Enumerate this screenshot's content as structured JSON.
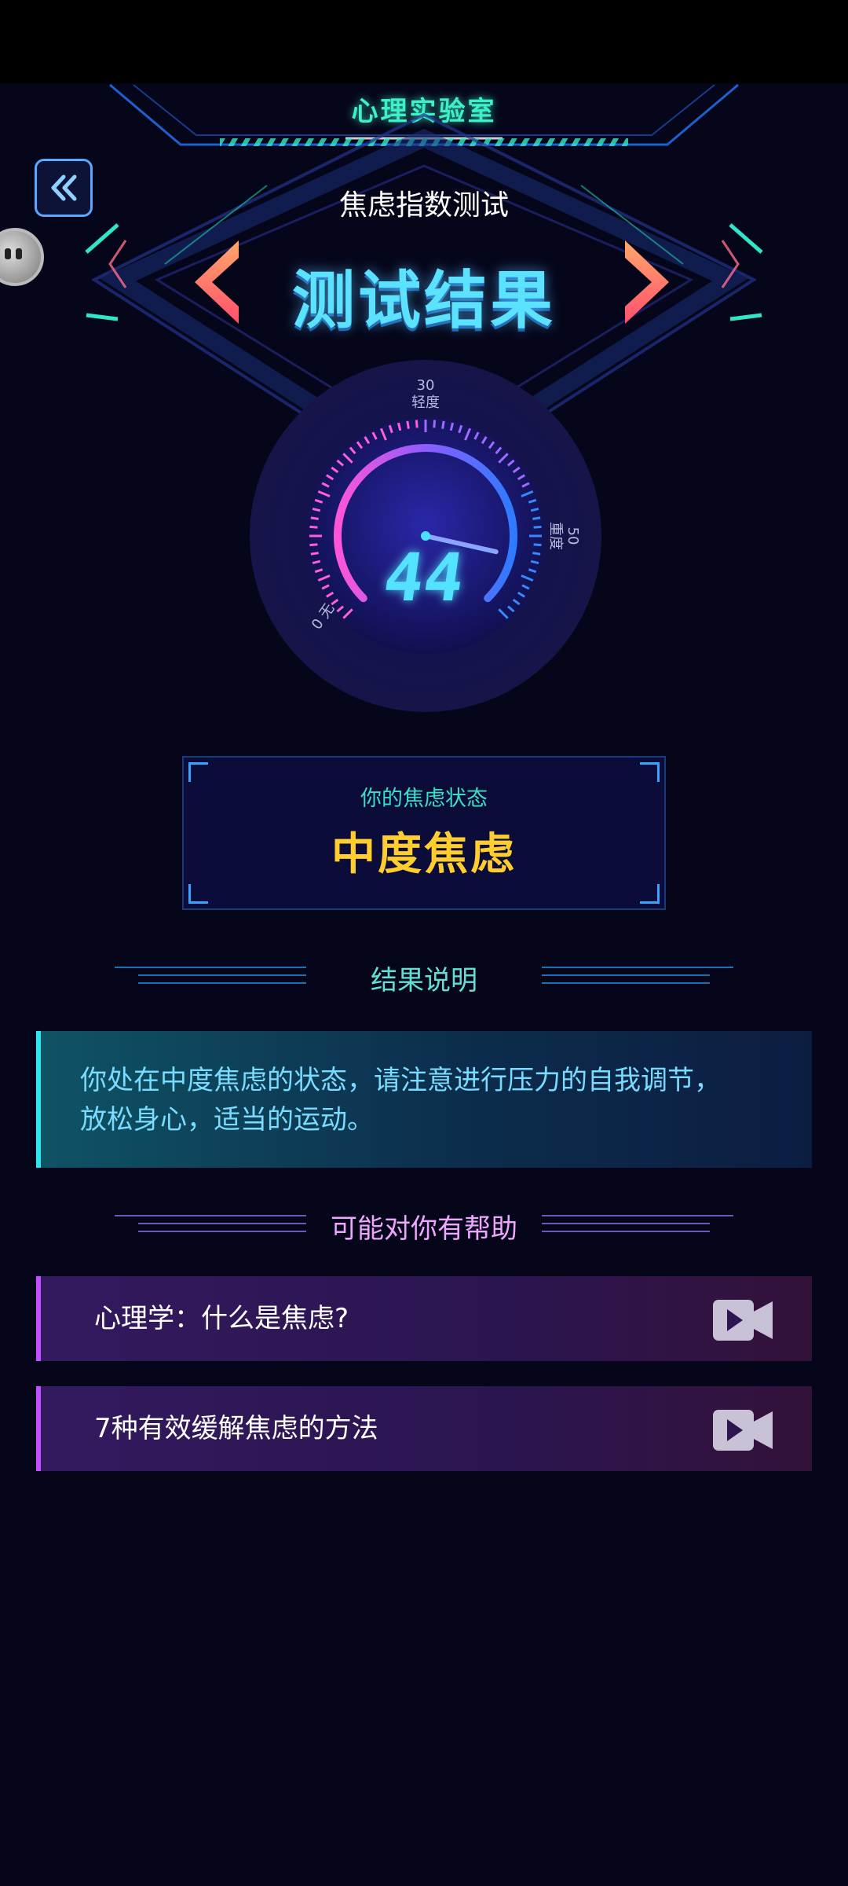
{
  "header": {
    "app_title": "心理实验室"
  },
  "page": {
    "subtitle": "焦虑指数测试",
    "result_title": "测试结果"
  },
  "gauge": {
    "score": "44",
    "score_value": 44,
    "min": 0,
    "max": 50,
    "labels": {
      "low_value": "0",
      "low_text": "无",
      "mid_value": "30",
      "mid_text": "轻度",
      "high_value": "50",
      "high_text": "重度"
    }
  },
  "status_card": {
    "label": "你的焦虑状态",
    "value": "中度焦虑"
  },
  "result_section": {
    "title": "结果说明",
    "description_line1": "你处在中度焦虑的状态，请注意进行压力的自我调节，",
    "description_line2": "放松身心，适当的运动。"
  },
  "help_section": {
    "title": "可能对你有帮助",
    "items": [
      {
        "label": "心理学：什么是焦虑?",
        "icon": "video-camera-icon"
      },
      {
        "label": "7种有效缓解焦虑的方法",
        "icon": "video-camera-icon"
      }
    ]
  },
  "colors": {
    "background": "#06061a",
    "accent_cyan": "#3ef0c8",
    "title_blue": "#5ae2ff",
    "status_yellow": "#ffce2e",
    "help_purple": "#c050ff",
    "help_title_pink": "#f0a6ff"
  }
}
